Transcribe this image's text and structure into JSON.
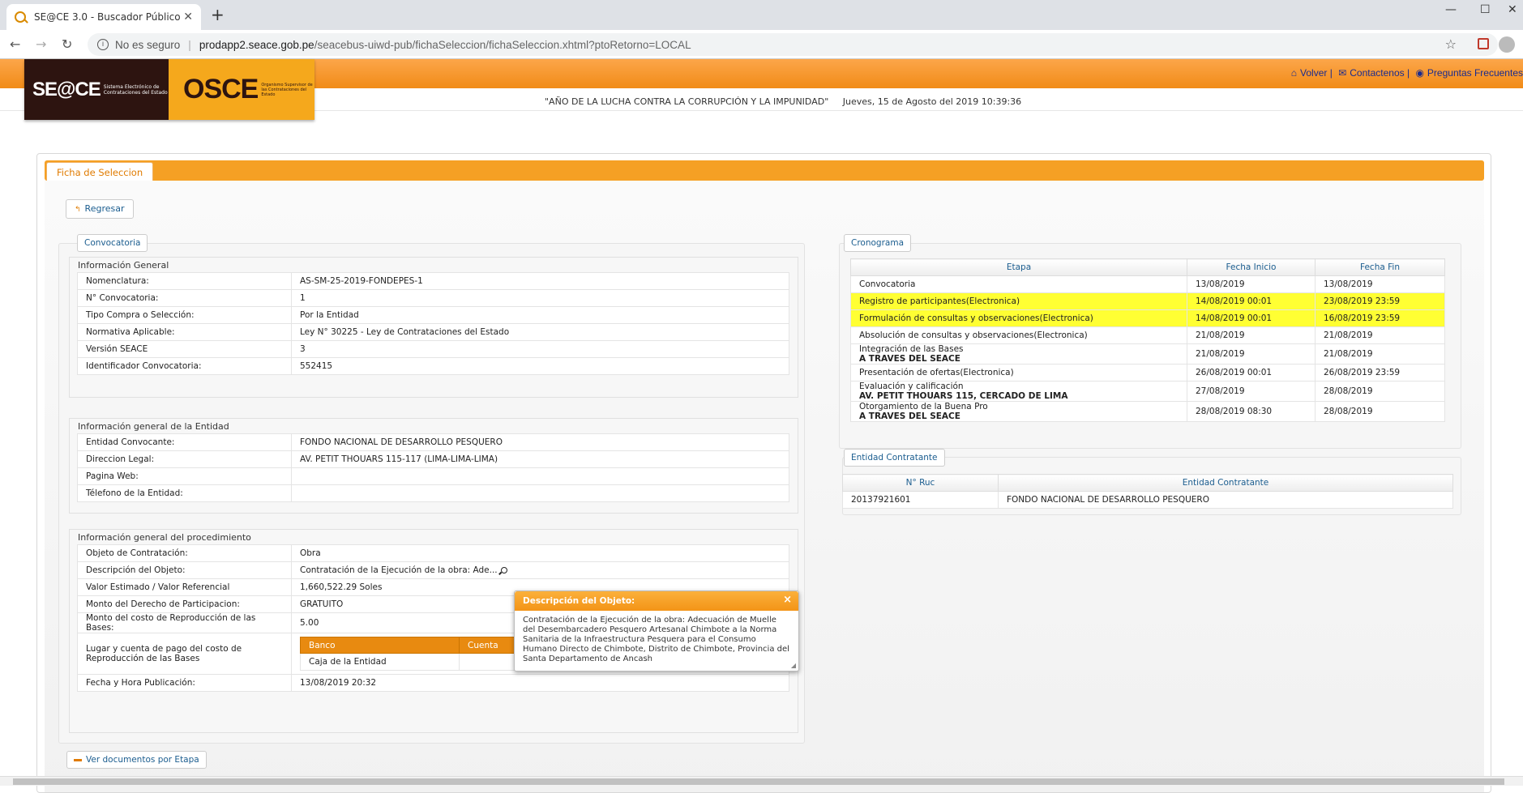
{
  "browser": {
    "tab_title": "SE@CE 3.0 - Buscador Público",
    "security": "No es seguro",
    "url_host": "prodapp2.seace.gob.pe",
    "url_path": "/seacebus-uiwd-pub/fichaSeleccion/fichaSeleccion.xhtml?ptoRetorno=LOCAL"
  },
  "header": {
    "logo_seace": "SE@CE",
    "logo_seace_sub": "Sistema Electrónico de Contrataciones del Estado",
    "logo_osce": "OSCE",
    "logo_osce_sub": "Organismo Supervisor de las Contrataciones del Estado",
    "link_volver": "Volver",
    "link_contactenos": "Contactenos",
    "link_preguntas": "Preguntas Frecuentes",
    "motto": "\"AÑO DE LA LUCHA CONTRA LA CORRUPCIÓN Y LA IMPUNIDAD\"",
    "datetime": "Jueves, 15 de Agosto del 2019 10:39:36"
  },
  "ficha": {
    "tab": "Ficha de Seleccion",
    "regresar": "Regresar",
    "convocatoria_legend": "Convocatoria",
    "info_general_title": "Información General",
    "info_general": [
      {
        "k": "Nomenclatura:",
        "v": "AS-SM-25-2019-FONDEPES-1"
      },
      {
        "k": "N° Convocatoria:",
        "v": "1"
      },
      {
        "k": "Tipo Compra o Selección:",
        "v": "Por la Entidad"
      },
      {
        "k": "Normativa Aplicable:",
        "v": "Ley N° 30225 - Ley de Contrataciones del Estado"
      },
      {
        "k": "Versión SEACE",
        "v": "3"
      },
      {
        "k": "Identificador Convocatoria:",
        "v": "552415"
      }
    ],
    "entidad_title": "Información general de la Entidad",
    "entidad": [
      {
        "k": "Entidad Convocante:",
        "v": "FONDO NACIONAL DE DESARROLLO PESQUERO"
      },
      {
        "k": "Direccion Legal:",
        "v": "AV. PETIT THOUARS 115-117 (LIMA-LIMA-LIMA)"
      },
      {
        "k": "Pagina Web:",
        "v": ""
      },
      {
        "k": "Télefono de la Entidad:",
        "v": ""
      }
    ],
    "proc_title": "Información general del procedimiento",
    "proc": [
      {
        "k": "Objeto de Contratación:",
        "v": "Obra"
      },
      {
        "k": "Descripción del Objeto:",
        "v": "Contratación de la Ejecución de la obra: Ade..."
      },
      {
        "k": "Valor Estimado / Valor Referencial",
        "v": "1,660,522.29 Soles"
      },
      {
        "k": "Monto del Derecho de Participacion:",
        "v": "GRATUITO"
      },
      {
        "k": "Monto del costo de Reproducción de las Bases:",
        "v": "5.00"
      },
      {
        "k": "Lugar y cuenta de pago del costo de Reproducción de las Bases",
        "v": ""
      },
      {
        "k": "Fecha y Hora Publicación:",
        "v": "13/08/2019 20:32"
      }
    ],
    "banco": {
      "h_banco": "Banco",
      "h_cuenta": "Cuenta",
      "banco": "Caja de la Entidad",
      "cuenta": ""
    },
    "cronograma_legend": "Cronograma",
    "crono_headers": [
      "Etapa",
      "Fecha Inicio",
      "Fecha Fin"
    ],
    "cronograma": [
      {
        "etapa": "Convocatoria",
        "sub": "",
        "ini": "13/08/2019",
        "fin": "13/08/2019",
        "hl": false
      },
      {
        "etapa": "Registro de participantes(Electronica)",
        "sub": "",
        "ini": "14/08/2019 00:01",
        "fin": "23/08/2019 23:59",
        "hl": true
      },
      {
        "etapa": "Formulación de consultas y observaciones(Electronica)",
        "sub": "",
        "ini": "14/08/2019 00:01",
        "fin": "16/08/2019 23:59",
        "hl": true
      },
      {
        "etapa": "Absolución de consultas y observaciones(Electronica)",
        "sub": "",
        "ini": "21/08/2019",
        "fin": "21/08/2019",
        "hl": false
      },
      {
        "etapa": "Integración de las Bases",
        "sub": "A TRAVES DEL SEACE",
        "ini": "21/08/2019",
        "fin": "21/08/2019",
        "hl": false
      },
      {
        "etapa": "Presentación de ofertas(Electronica)",
        "sub": "",
        "ini": "26/08/2019 00:01",
        "fin": "26/08/2019 23:59",
        "hl": false
      },
      {
        "etapa": "Evaluación y calificación",
        "sub": "AV. PETIT THOUARS 115, CERCADO DE LIMA",
        "ini": "27/08/2019",
        "fin": "28/08/2019",
        "hl": false
      },
      {
        "etapa": "Otorgamiento de la Buena Pro",
        "sub": "A TRAVES DEL SEACE",
        "ini": "28/08/2019 08:30",
        "fin": "28/08/2019",
        "hl": false
      }
    ],
    "entidad_contratante_legend": "Entidad Contratante",
    "ec_headers": [
      "N° Ruc",
      "Entidad Contratante"
    ],
    "ec_row": {
      "ruc": "20137921601",
      "nombre": "FONDO NACIONAL DE DESARROLLO PESQUERO"
    },
    "ver_documentos": "Ver documentos por Etapa"
  },
  "popup": {
    "title": "Descripción del Objeto:",
    "close": "×",
    "body": "Contratación de la Ejecución de la obra: Adecuación de Muelle del Desembarcadero Pesquero Artesanal Chimbote a la Norma Sanitaria de la Infraestructura Pesquera para el Consumo Humano Directo de Chimbote, Distrito de Chimbote, Provincia del Santa Departamento de Ancash"
  }
}
